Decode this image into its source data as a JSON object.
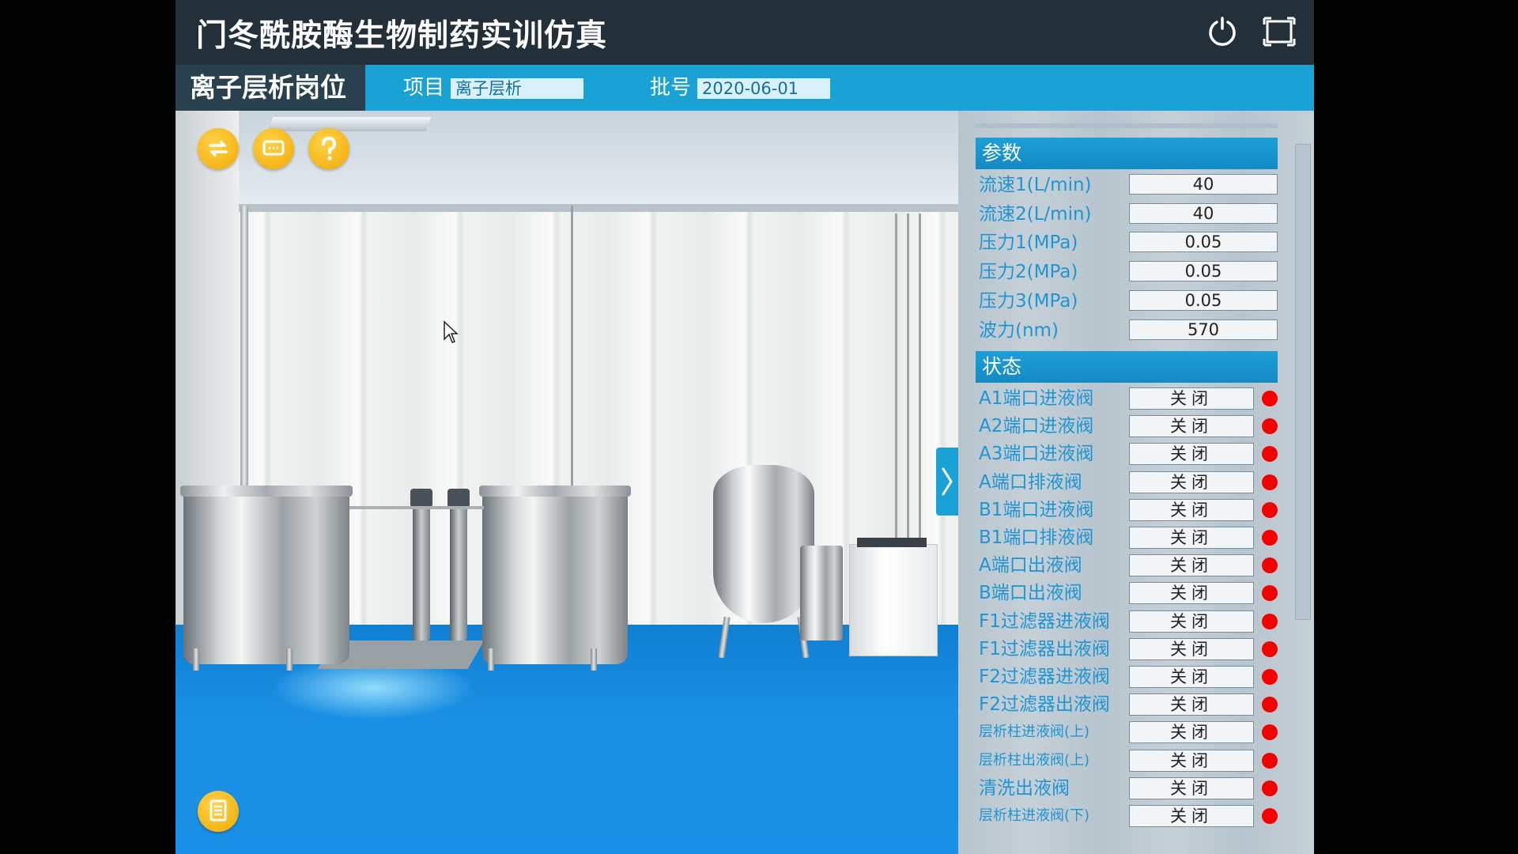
{
  "app": {
    "title": "门冬酰胺酶生物制药实训仿真"
  },
  "window_controls": {
    "power_icon": "power-icon",
    "fullscreen_icon": "fullscreen-icon"
  },
  "header": {
    "station": "离子层析岗位",
    "project_label": "项目",
    "project_value": "离子层析",
    "batch_label": "批号",
    "batch_value": "2020-06-01"
  },
  "toolbar": {
    "icons": [
      "refresh-icon",
      "message-icon",
      "help-icon"
    ],
    "bottom_icon": "document-icon"
  },
  "panel": {
    "params_title": "参数",
    "params": [
      {
        "name": "流速1(L/min)",
        "value": "40"
      },
      {
        "name": "流速2(L/min)",
        "value": "40"
      },
      {
        "name": "压力1(MPa)",
        "value": "0.05"
      },
      {
        "name": "压力2(MPa)",
        "value": "0.05"
      },
      {
        "name": "压力3(MPa)",
        "value": "0.05"
      },
      {
        "name": "波力(nm)",
        "value": "570"
      }
    ],
    "status_title": "状态",
    "status": [
      {
        "name": "A1端口进液阀",
        "value": "关闭",
        "indicator": "#f40000"
      },
      {
        "name": "A2端口进液阀",
        "value": "关闭",
        "indicator": "#f40000"
      },
      {
        "name": "A3端口进液阀",
        "value": "关闭",
        "indicator": "#f40000"
      },
      {
        "name": "A端口排液阀",
        "value": "关闭",
        "indicator": "#f40000"
      },
      {
        "name": "B1端口进液阀",
        "value": "关闭",
        "indicator": "#f40000"
      },
      {
        "name": "B1端口排液阀",
        "value": "关闭",
        "indicator": "#f40000"
      },
      {
        "name": "A端口出液阀",
        "value": "关闭",
        "indicator": "#f40000"
      },
      {
        "name": "B端口出液阀",
        "value": "关闭",
        "indicator": "#f40000"
      },
      {
        "name": "F1过滤器进液阀",
        "value": "关闭",
        "indicator": "#f40000"
      },
      {
        "name": "F1过滤器出液阀",
        "value": "关闭",
        "indicator": "#f40000"
      },
      {
        "name": "F2过滤器进液阀",
        "value": "关闭",
        "indicator": "#f40000"
      },
      {
        "name": "F2过滤器出液阀",
        "value": "关闭",
        "indicator": "#f40000"
      },
      {
        "name": "层析柱进液阀(上)",
        "value": "关闭",
        "indicator": "#f40000"
      },
      {
        "name": "层析柱出液阀(上)",
        "value": "关闭",
        "indicator": "#f40000"
      },
      {
        "name": "清洗出液阀",
        "value": "关闭",
        "indicator": "#f40000"
      },
      {
        "name": "层析柱进液阀(下)",
        "value": "关闭",
        "indicator": "#f40000"
      }
    ]
  },
  "colors": {
    "accent": "#1aa2d6",
    "header_dark": "#23303a",
    "button_yellow": "#f2a900",
    "floor_blue": "#1a8fe3",
    "status_red": "#f40000"
  }
}
